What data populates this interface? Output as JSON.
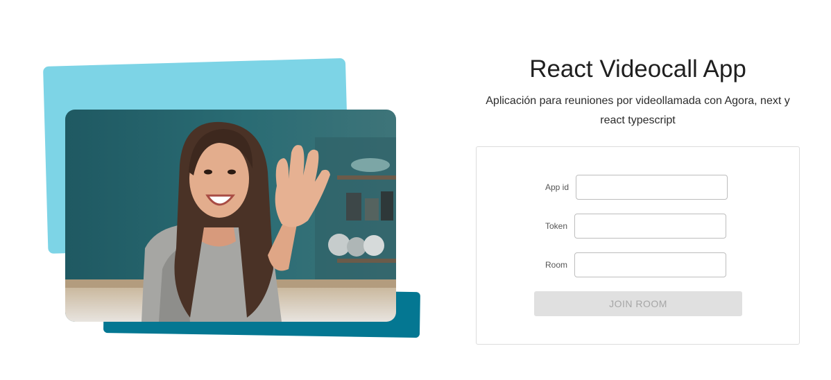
{
  "hero": {
    "image_icon": "woman-waving-photo",
    "colors": {
      "light_shape": "#7dd4e6",
      "dark_shape": "#047792"
    }
  },
  "header": {
    "title": "React Videocall App",
    "subtitle": "Aplicación para reuniones por videollamada con Agora, next y react typescript"
  },
  "form": {
    "fields": [
      {
        "label": "App id",
        "value": "",
        "placeholder": ""
      },
      {
        "label": "Token",
        "value": "",
        "placeholder": ""
      },
      {
        "label": "Room",
        "value": "",
        "placeholder": ""
      }
    ],
    "join_button": "JOIN ROOM"
  }
}
